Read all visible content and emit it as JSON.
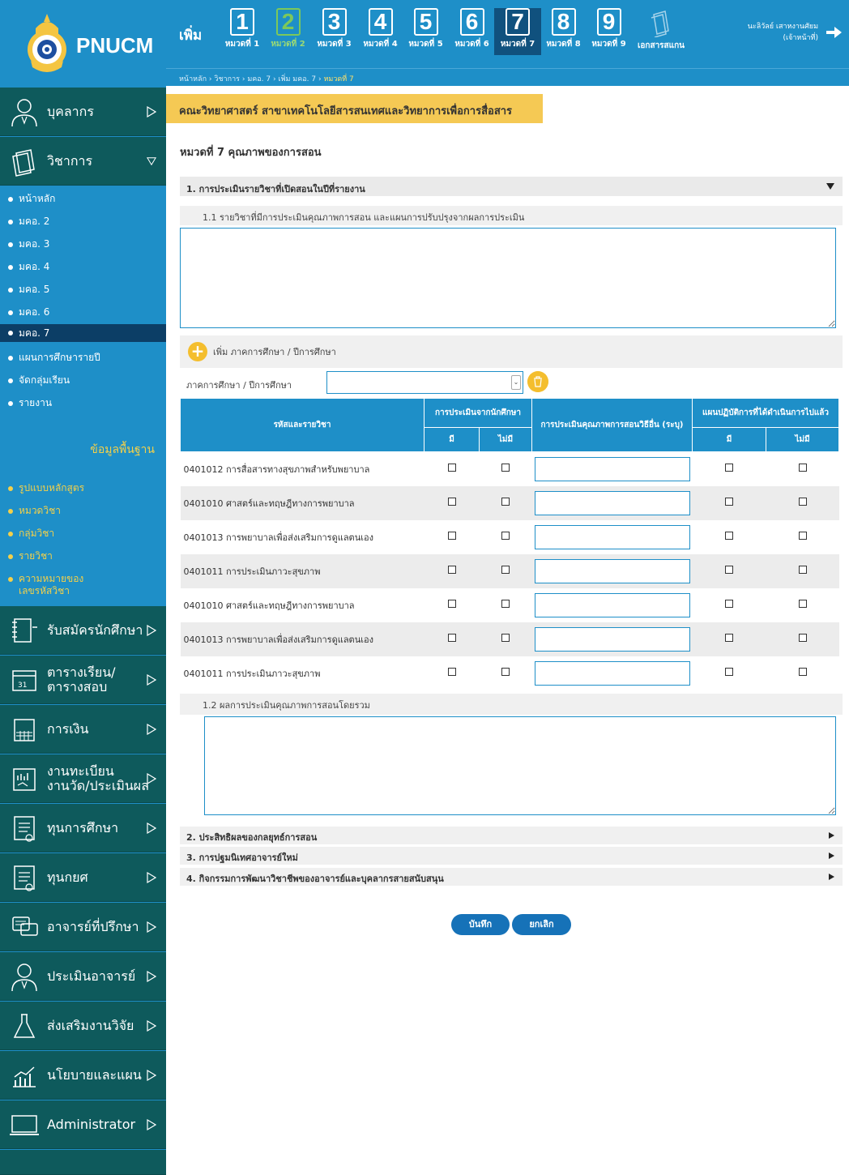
{
  "app": {
    "logo_text": "PNUCM"
  },
  "header": {
    "add_label": "เพิ่ม",
    "steps": [
      {
        "num": "1",
        "label": "หมวดที่ 1"
      },
      {
        "num": "2",
        "label": "หมวดที่ 2"
      },
      {
        "num": "3",
        "label": "หมวดที่ 3"
      },
      {
        "num": "4",
        "label": "หมวดที่ 4"
      },
      {
        "num": "5",
        "label": "หมวดที่ 5"
      },
      {
        "num": "6",
        "label": "หมวดที่ 6"
      },
      {
        "num": "7",
        "label": "หมวดที่ 7"
      },
      {
        "num": "8",
        "label": "หมวดที่ 8"
      },
      {
        "num": "9",
        "label": "หมวดที่ 9"
      },
      {
        "num": "",
        "label": "เอกสารสแกน"
      }
    ],
    "user_name": "นะลิวัลย์ เสาหงานศัยม",
    "user_role": "(เจ้าหน้าที่)"
  },
  "breadcrumb": {
    "items": [
      "หน้าหลัก",
      "วิชาการ",
      "มคอ. 7",
      "เพิ่ม มคอ. 7"
    ],
    "current": "หมวดที่ 7",
    "sep": "›"
  },
  "sidebar": {
    "personnel": "บุคลากร",
    "academic": "วิชาการ",
    "academic_items": [
      "หน้าหลัก",
      "มคอ. 2",
      "มคอ. 3",
      "มคอ. 4",
      "มคอ. 5",
      "มคอ. 6",
      "มคอ. 7",
      "แผนการศึกษารายปี",
      "จัดกลุ่มเรียน",
      "รายงาน"
    ],
    "base_title": "ข้อมูลพื้นฐาน",
    "base_items": [
      "รูปแบบหลักสูตร",
      "หมวดวิชา",
      "กลุ่มวิชา",
      "รายวิชา",
      "ความหมายของ",
      "เลขรหัสวิชา"
    ],
    "menus": [
      {
        "line1": "รับสมัครนักศึกษา",
        "line2": ""
      },
      {
        "line1": "ตารางเรียน/",
        "line2": "ตารางสอบ"
      },
      {
        "line1": "การเงิน",
        "line2": ""
      },
      {
        "line1": "งานทะเบียน",
        "line2": "งานวัด/ประเมินผล"
      },
      {
        "line1": "ทุนการศึกษา",
        "line2": ""
      },
      {
        "line1": "ทุนกยศ",
        "line2": ""
      },
      {
        "line1": "อาจารย์ที่ปรึกษา",
        "line2": ""
      },
      {
        "line1": "ประเมินอาจารย์",
        "line2": ""
      },
      {
        "line1": "ส่งเสริมงานวิจัย",
        "line2": ""
      },
      {
        "line1": "นโยบายและแผน",
        "line2": ""
      },
      {
        "line1": "Administrator",
        "line2": ""
      }
    ]
  },
  "main": {
    "faculty": "คณะวิทยาศาสตร์ สาขาเทคโนโลยีสารสนเทศและวิทยาการเพื่อการสื่อสาร",
    "section_title": "หมวดที่ 7 คุณภาพของการสอน",
    "acc1": "1. การประเมินรายวิชาที่เปิดสอนในปีที่รายงาน",
    "sub11": "1.1 รายวิชาที่มีการประเมินคุณภาพการสอน และแผนการปรับปรุงจากผลการประเมิน",
    "add_term": "เพิ่ม ภาคการศึกษา / ปีการศึกษา",
    "term_label": "ภาคการศึกษา / ปีการศึกษา",
    "table": {
      "col_course": "รหัสและรายวิชา",
      "col_student_eval": "การประเมินจากนักศึกษา",
      "col_other_eval": "การประเมินคุณภาพการสอนวิธีอื่น (ระบุ)",
      "col_action_plan": "แผนปฏิบัติการที่ได้ดำเนินการไปแล้ว",
      "yes": "มี",
      "no": "ไม่มี",
      "rows": [
        "0401012 การสื่อสารทางสุขภาพสำหรับพยาบาล",
        "0401010 ศาสตร์และทฤษฎีทางการพยาบาล",
        "0401013 การพยาบาลเพื่อส่งเสริมการดูแลตนเอง",
        "0401011 การประเมินภาวะสุขภาพ",
        "0401010 ศาสตร์และทฤษฎีทางการพยาบาล",
        "0401013 การพยาบาลเพื่อส่งเสริมการดูแลตนเอง",
        "0401011 การประเมินภาวะสุขภาพ"
      ]
    },
    "sub12": "1.2 ผลการประเมินคุณภาพการสอนโดยรวม",
    "acc2": "2. ประสิทธิผลของกลยุทธ์การสอน",
    "acc3": "3. การปฐมนิเทศอาจารย์ใหม่",
    "acc4": "4. กิจกรรมการพัฒนาวิชาชีพของอาจารย์และบุคลากรสายสนับสนุน",
    "save": "บันทึก",
    "cancel": "ยกเลิก"
  }
}
